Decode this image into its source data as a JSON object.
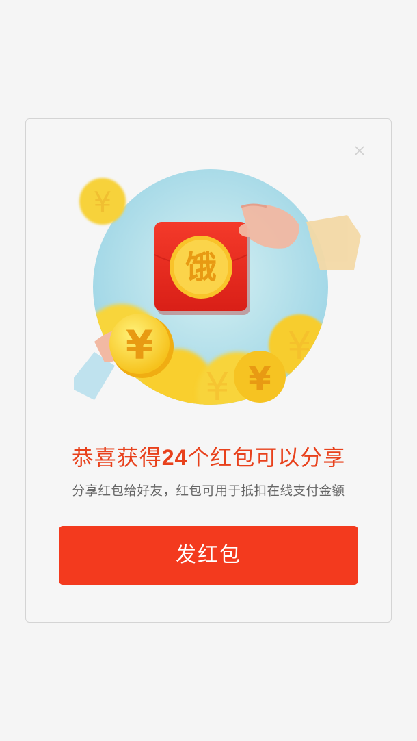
{
  "dialog": {
    "close_icon": "close-icon",
    "illustration": {
      "badge_char": "饿",
      "coin_symbol": "¥",
      "colors": {
        "circle_bg": "#bfe6ee",
        "envelope": "#ef2f21",
        "coin": "#f9c82a",
        "coin_text": "#e89a13"
      }
    },
    "title_prefix": "恭喜获得",
    "title_count": "24",
    "title_suffix": "个红包可以分享",
    "subtitle": "分享红包给好友，红包可用于抵扣在线支付金额",
    "button_label": "发红包",
    "colors": {
      "accent_text": "#e8411c",
      "button_bg": "#f33a1e",
      "button_text": "#ffffff",
      "subtitle_text": "#666666"
    }
  }
}
